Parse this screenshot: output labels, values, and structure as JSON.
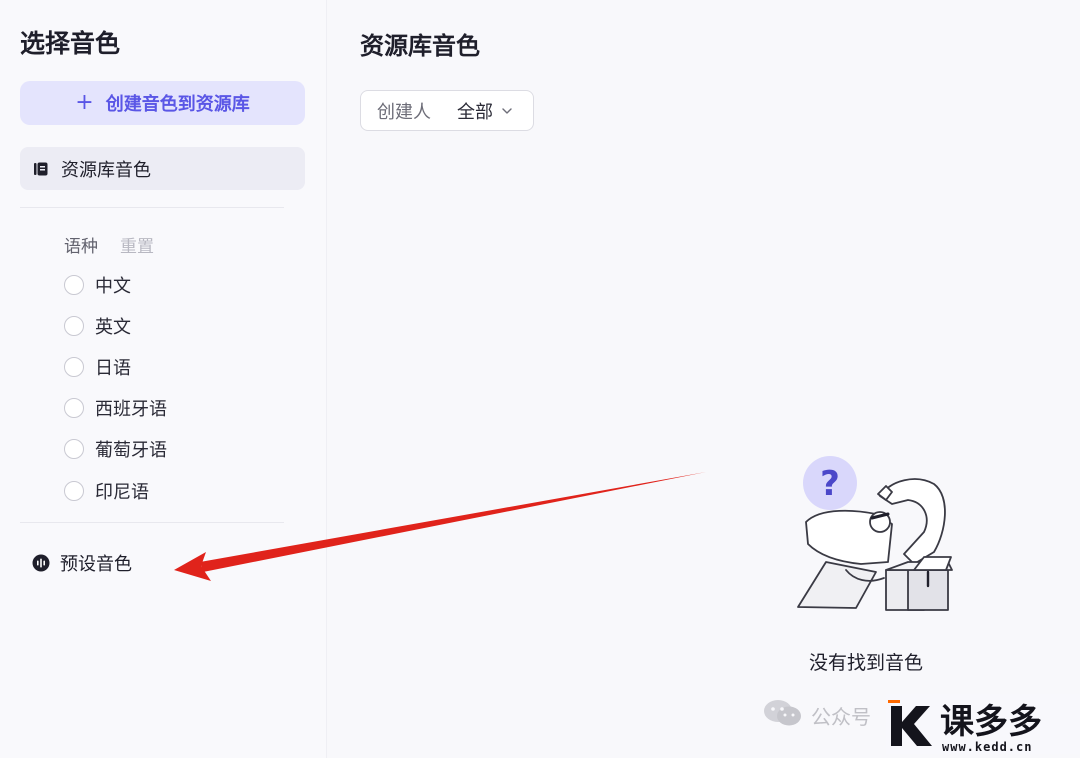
{
  "sidebar": {
    "title": "选择音色",
    "create_button": "创建音色到资源库",
    "library_item": "资源库音色",
    "filter_label": "语种",
    "filter_reset": "重置",
    "languages": [
      "中文",
      "英文",
      "日语",
      "西班牙语",
      "葡萄牙语",
      "印尼语"
    ],
    "preset_item": "预设音色"
  },
  "main": {
    "title": "资源库音色",
    "creator_filter": {
      "label": "创建人",
      "value": "全部"
    },
    "empty_text": "没有找到音色"
  },
  "watermark": {
    "wechat_text": "公众号",
    "logo_text": "课多多",
    "logo_url": "www.kedd.cn"
  },
  "colors": {
    "accent": "#5a56e6",
    "accent_bg": "#e4e4fd",
    "annotation_arrow": "#e0231b"
  },
  "icons": [
    "plus-icon",
    "library-icon",
    "chevron-down-icon",
    "voice-icon",
    "wechat-icon",
    "question-icon"
  ]
}
